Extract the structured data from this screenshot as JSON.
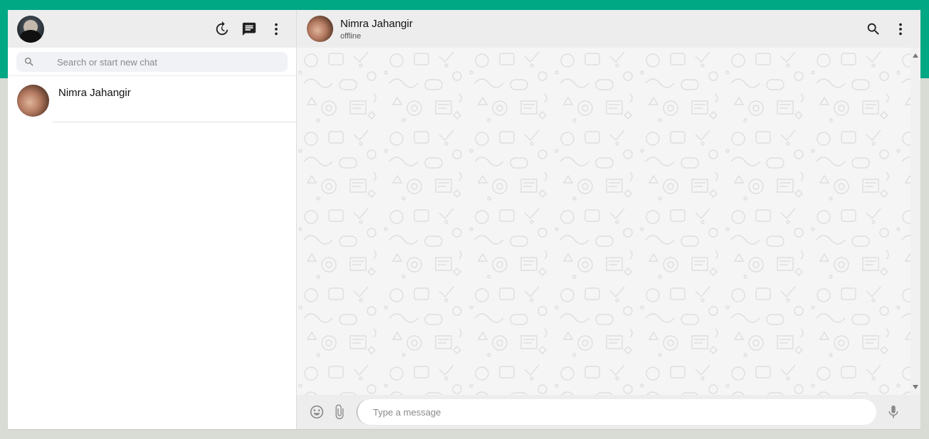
{
  "sidebar": {
    "search_placeholder": "Search or start new chat",
    "chats": [
      {
        "name": "Nimra Jahangir"
      }
    ]
  },
  "conversation": {
    "contact_name": "Nimra Jahangir",
    "status": "offline",
    "input_placeholder": "Type a message"
  },
  "colors": {
    "accent": "#00a884",
    "header_bg": "#ededed",
    "wallpaper_bg": "#f5f5f5"
  },
  "icons": {
    "sidebar_header": [
      "status-icon",
      "new-chat-icon",
      "menu-icon"
    ],
    "convo_header": [
      "search-icon",
      "menu-icon"
    ],
    "composer": [
      "emoji-icon",
      "attach-icon",
      "mic-icon"
    ]
  }
}
